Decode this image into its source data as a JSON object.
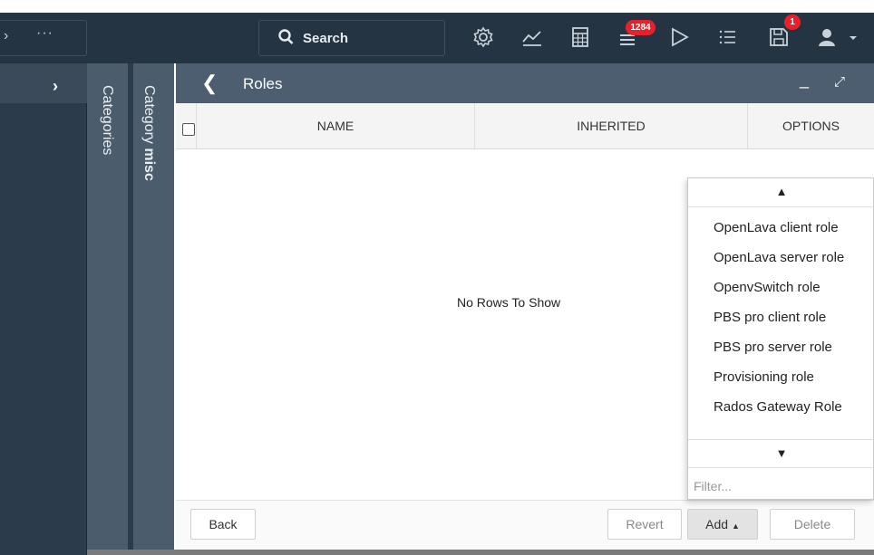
{
  "topbar": {
    "search_label": "Search",
    "notifications_badge": "1284",
    "save_badge": "1"
  },
  "vertical_tabs": {
    "categories": "Categories",
    "category_prefix": "Category ",
    "category_name": "misc"
  },
  "window": {
    "title": "Roles"
  },
  "table": {
    "columns": [
      "NAME",
      "INHERITED",
      "OPTIONS"
    ],
    "empty_message": "No Rows To Show"
  },
  "footer": {
    "back": "Back",
    "revert": "Revert",
    "add": "Add",
    "delete": "Delete"
  },
  "dropdown": {
    "items": [
      "OpenLava client role",
      "OpenLava server role",
      "OpenvSwitch role",
      "PBS pro client role",
      "PBS pro server role",
      "Provisioning role",
      "Rados Gateway Role"
    ],
    "filter_placeholder": "Filter..."
  },
  "colors": {
    "topbar_bg": "#243443",
    "window_header_bg": "#4c5e6f",
    "badge_red": "#e8202a"
  }
}
